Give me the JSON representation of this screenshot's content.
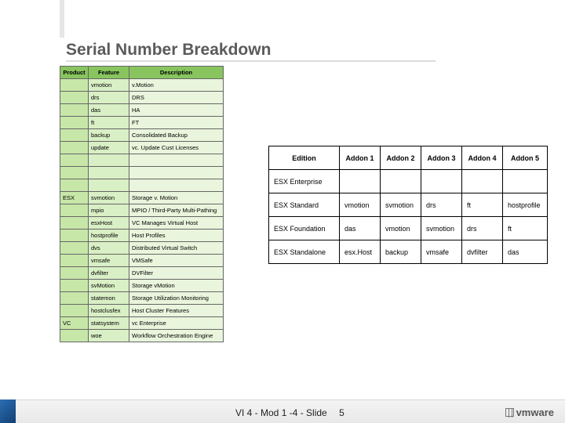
{
  "title": "Serial Number Breakdown",
  "left_table": {
    "headers": {
      "product": "Product",
      "feature": "Feature",
      "description": "Description"
    },
    "rows": [
      {
        "product": "",
        "feature": "vmotion",
        "description": "v.Motion"
      },
      {
        "product": "",
        "feature": "drs",
        "description": "DRS"
      },
      {
        "product": "",
        "feature": "das",
        "description": "HA"
      },
      {
        "product": "",
        "feature": "ft",
        "description": "FT"
      },
      {
        "product": "",
        "feature": "backup",
        "description": "Consolidated Backup"
      },
      {
        "product": "",
        "feature": "update",
        "description": "vc. Update Cust Licenses"
      },
      {
        "product": "",
        "feature": "",
        "description": ""
      },
      {
        "product": "",
        "feature": "",
        "description": ""
      },
      {
        "product": "",
        "feature": "",
        "description": ""
      },
      {
        "product": "ESX",
        "feature": "svmotion",
        "description": "Storage v. Motion"
      },
      {
        "product": "",
        "feature": "mpio",
        "description": "MPIO / Third-Party Multi-Pathing"
      },
      {
        "product": "",
        "feature": "esxHost",
        "description": "VC Manages Virtual Host"
      },
      {
        "product": "",
        "feature": "hostprofile",
        "description": "Host Profiles"
      },
      {
        "product": "",
        "feature": "dvs",
        "description": "Distributed Virtual Switch"
      },
      {
        "product": "",
        "feature": "vmsafe",
        "description": "VMSafe"
      },
      {
        "product": "",
        "feature": "dvfilter",
        "description": "DVFilter"
      },
      {
        "product": "",
        "feature": "svMotion",
        "description": "Storage vMotion"
      },
      {
        "product": "",
        "feature": "statemon",
        "description": "Storage Utilization Monitoring"
      },
      {
        "product": "",
        "feature": "hostclusfex",
        "description": "Host Cluster Features"
      },
      {
        "product": "VC",
        "feature": "statsystem",
        "description": "vc Enterprise"
      },
      {
        "product": "",
        "feature": "woe",
        "description": "Workflow Orchestration Engine"
      }
    ]
  },
  "right_table": {
    "headers": {
      "edition": "Edition",
      "a1": "Addon 1",
      "a2": "Addon 2",
      "a3": "Addon 3",
      "a4": "Addon 4",
      "a5": "Addon 5"
    },
    "rows": [
      {
        "edition": "ESX Enterprise",
        "a1": "",
        "a2": "",
        "a3": "",
        "a4": "",
        "a5": ""
      },
      {
        "edition": "ESX Standard",
        "a1": "vmotion",
        "a2": "svmotion",
        "a3": "drs",
        "a4": "ft",
        "a5": "hostprofile"
      },
      {
        "edition": "ESX Foundation",
        "a1": "das",
        "a2": "vmotion",
        "a3": "svmotion",
        "a4": "drs",
        "a5": "ft"
      },
      {
        "edition": "ESX Standalone",
        "a1": "esx.Host",
        "a2": "backup",
        "a3": "vmsafe",
        "a4": "dvfilter",
        "a5": "das"
      }
    ]
  },
  "footer": {
    "slide_text": "VI 4 - Mod 1 -4 - Slide",
    "page": "5",
    "logo_text": "vmware"
  }
}
